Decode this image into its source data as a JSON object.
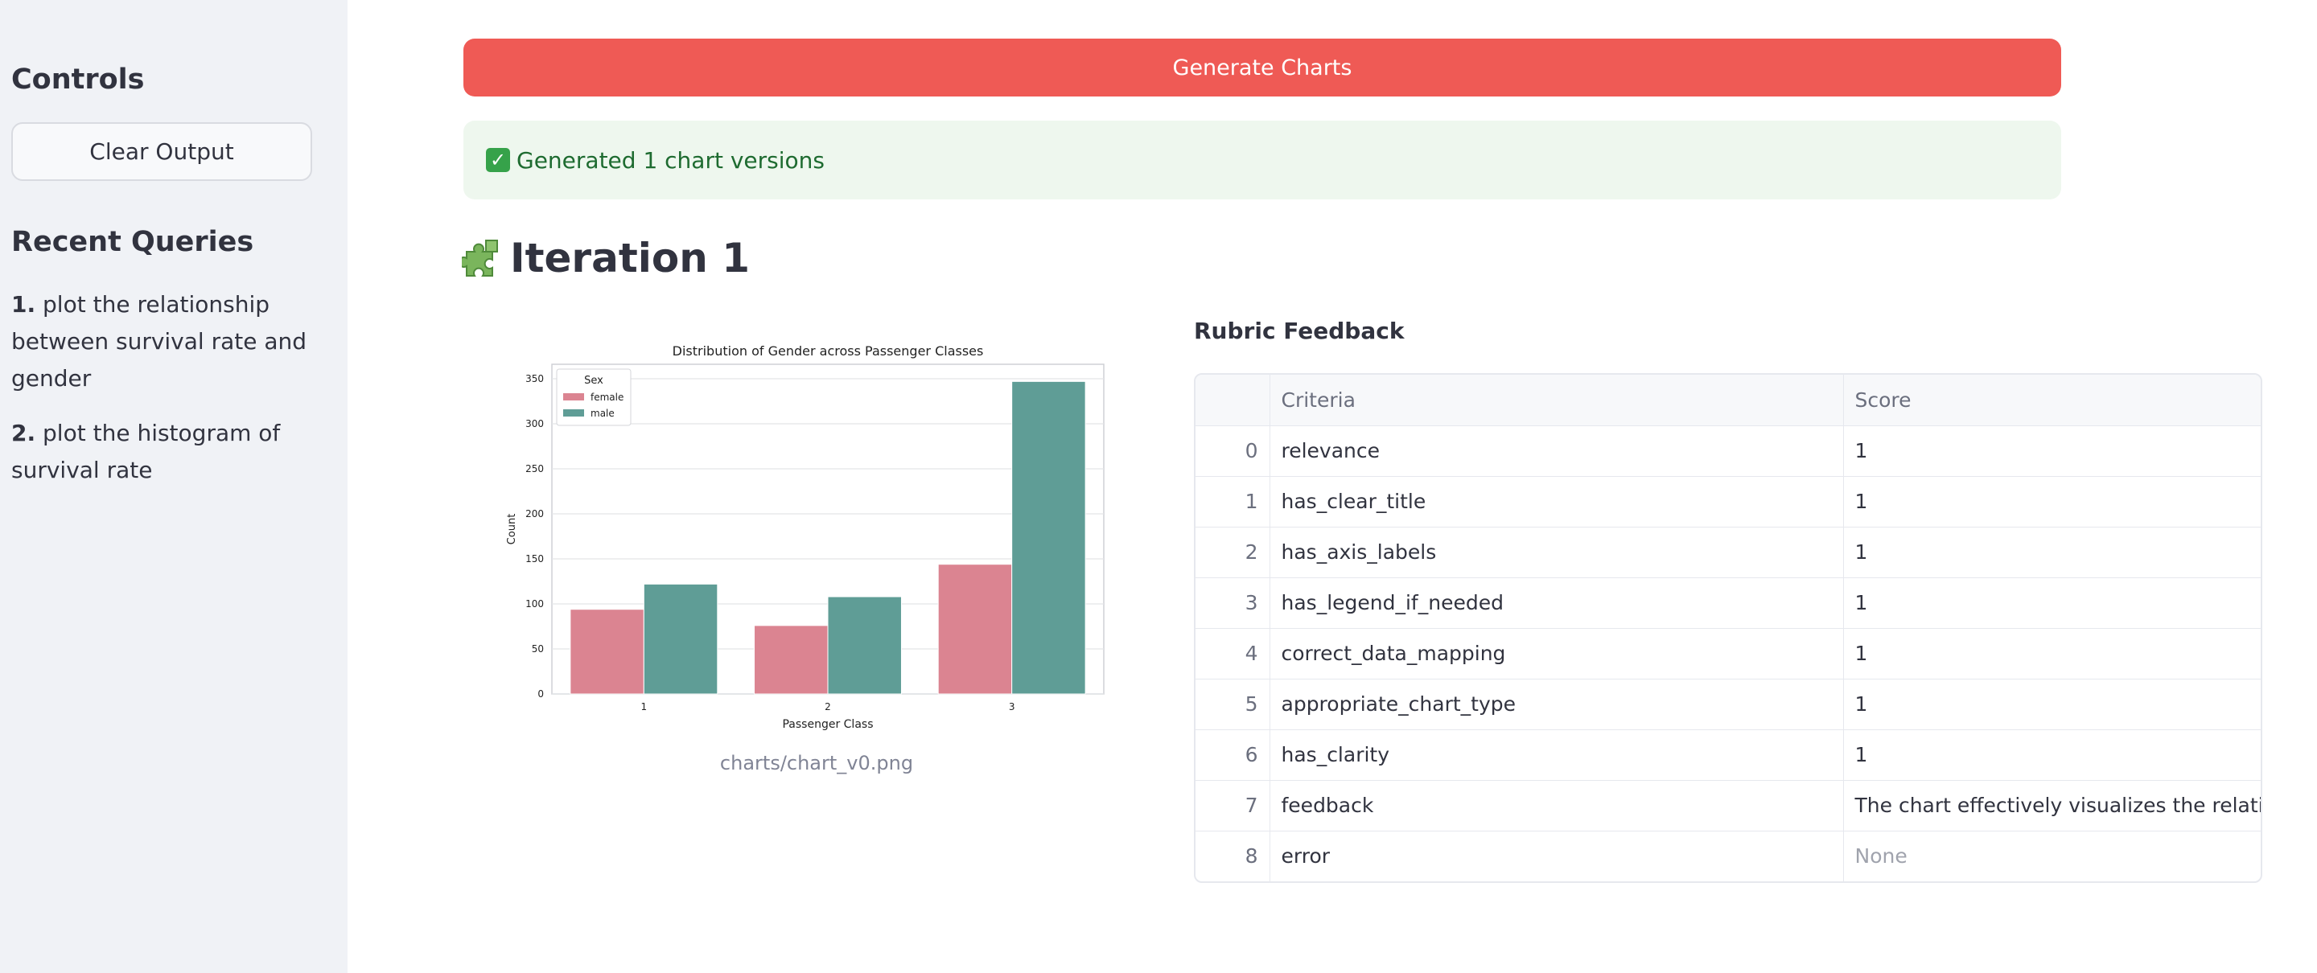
{
  "sidebar": {
    "controls_heading": "Controls",
    "clear_button": "Clear Output",
    "recent_heading": "Recent Queries",
    "queries": [
      {
        "num": "1.",
        "text": "plot the relationship between survival rate and gender"
      },
      {
        "num": "2.",
        "text": "plot the histogram of survival rate"
      }
    ]
  },
  "main": {
    "generate_button": "Generate Charts",
    "status_message": "Generated 1 chart versions",
    "iteration_title": "Iteration 1",
    "chart_caption": "charts/chart_v0.png",
    "rubric_title": "Rubric Feedback"
  },
  "colors": {
    "accent": "#ef5a55",
    "success_bg": "#eef7ee",
    "female": "#db8491",
    "male": "#5f9d96"
  },
  "table": {
    "headers": [
      "",
      "Criteria",
      "Score"
    ],
    "rows": [
      {
        "idx": "0",
        "criteria": "relevance",
        "score": "1"
      },
      {
        "idx": "1",
        "criteria": "has_clear_title",
        "score": "1"
      },
      {
        "idx": "2",
        "criteria": "has_axis_labels",
        "score": "1"
      },
      {
        "idx": "3",
        "criteria": "has_legend_if_needed",
        "score": "1"
      },
      {
        "idx": "4",
        "criteria": "correct_data_mapping",
        "score": "1"
      },
      {
        "idx": "5",
        "criteria": "appropriate_chart_type",
        "score": "1"
      },
      {
        "idx": "6",
        "criteria": "has_clarity",
        "score": "1"
      },
      {
        "idx": "7",
        "criteria": "feedback",
        "score": "The chart effectively visualizes the relationship b"
      },
      {
        "idx": "8",
        "criteria": "error",
        "score": "None"
      }
    ]
  },
  "chart_data": {
    "type": "bar",
    "title": "Distribution of Gender across Passenger Classes",
    "xlabel": "Passenger Class",
    "ylabel": "Count",
    "categories": [
      "1",
      "2",
      "3"
    ],
    "series": [
      {
        "name": "female",
        "values": [
          94,
          76,
          144
        ]
      },
      {
        "name": "male",
        "values": [
          122,
          108,
          347
        ]
      }
    ],
    "legend_title": "Sex",
    "legend_position": "top-left",
    "ylim": [
      0,
      350
    ],
    "yticks": [
      0,
      50,
      100,
      150,
      200,
      250,
      300,
      350
    ],
    "grid": true
  }
}
